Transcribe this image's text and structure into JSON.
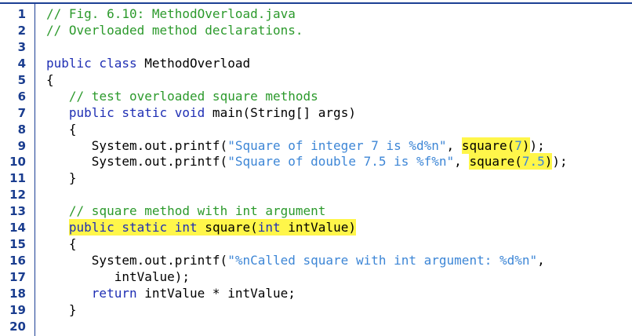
{
  "listing": {
    "lines": [
      {
        "num": "1",
        "tokens": [
          {
            "t": "// Fig. 6.10: MethodOverload.java",
            "c": "comment"
          }
        ]
      },
      {
        "num": "2",
        "tokens": [
          {
            "t": "// Overloaded method declarations.",
            "c": "comment"
          }
        ]
      },
      {
        "num": "3",
        "tokens": []
      },
      {
        "num": "4",
        "tokens": [
          {
            "t": "public class",
            "c": "kw"
          },
          {
            "t": " MethodOverload",
            "c": "plain"
          }
        ]
      },
      {
        "num": "5",
        "tokens": [
          {
            "t": "{",
            "c": "plain"
          }
        ]
      },
      {
        "num": "6",
        "tokens": [
          {
            "t": "   ",
            "c": "plain"
          },
          {
            "t": "// test overloaded square methods",
            "c": "comment"
          }
        ]
      },
      {
        "num": "7",
        "tokens": [
          {
            "t": "   ",
            "c": "plain"
          },
          {
            "t": "public static void",
            "c": "kw"
          },
          {
            "t": " main(String[] args)",
            "c": "plain"
          }
        ]
      },
      {
        "num": "8",
        "tokens": [
          {
            "t": "   {",
            "c": "plain"
          }
        ]
      },
      {
        "num": "9",
        "tokens": [
          {
            "t": "      System.out.printf(",
            "c": "plain"
          },
          {
            "t": "\"Square of integer 7 is %d%n\"",
            "c": "str"
          },
          {
            "t": ", ",
            "c": "plain"
          },
          {
            "t": "square(",
            "c": "plain",
            "hl": true
          },
          {
            "t": "7",
            "c": "str",
            "hl": true
          },
          {
            "t": ")",
            "c": "plain",
            "hl": true
          },
          {
            "t": ");",
            "c": "plain"
          }
        ]
      },
      {
        "num": "10",
        "tokens": [
          {
            "t": "      System.out.printf(",
            "c": "plain"
          },
          {
            "t": "\"Square of double 7.5 is %f%n\"",
            "c": "str"
          },
          {
            "t": ", ",
            "c": "plain"
          },
          {
            "t": "square(",
            "c": "plain",
            "hl": true
          },
          {
            "t": "7.5",
            "c": "str",
            "hl": true
          },
          {
            "t": ")",
            "c": "plain",
            "hl": true
          },
          {
            "t": ");",
            "c": "plain"
          }
        ]
      },
      {
        "num": "11",
        "tokens": [
          {
            "t": "   }",
            "c": "plain"
          }
        ]
      },
      {
        "num": "12",
        "tokens": []
      },
      {
        "num": "13",
        "tokens": [
          {
            "t": "   ",
            "c": "plain"
          },
          {
            "t": "// square method with int argument",
            "c": "comment"
          }
        ]
      },
      {
        "num": "14",
        "tokens": [
          {
            "t": "   ",
            "c": "plain"
          },
          {
            "t": "public static int",
            "c": "kw",
            "hl": true
          },
          {
            "t": " square(",
            "c": "plain",
            "hl": true
          },
          {
            "t": "int",
            "c": "kw",
            "hl": true
          },
          {
            "t": " intValue)",
            "c": "plain",
            "hl": true
          }
        ]
      },
      {
        "num": "15",
        "tokens": [
          {
            "t": "   {",
            "c": "plain"
          }
        ]
      },
      {
        "num": "16",
        "tokens": [
          {
            "t": "      System.out.printf(",
            "c": "plain"
          },
          {
            "t": "\"%nCalled square with int argument: %d%n\"",
            "c": "str"
          },
          {
            "t": ",",
            "c": "plain"
          }
        ]
      },
      {
        "num": "17",
        "tokens": [
          {
            "t": "         intValue);",
            "c": "plain"
          }
        ]
      },
      {
        "num": "18",
        "tokens": [
          {
            "t": "      ",
            "c": "plain"
          },
          {
            "t": "return",
            "c": "kw"
          },
          {
            "t": " intValue * intValue;",
            "c": "plain"
          }
        ]
      },
      {
        "num": "19",
        "tokens": [
          {
            "t": "   }",
            "c": "plain"
          }
        ]
      },
      {
        "num": "20",
        "tokens": []
      }
    ]
  },
  "colors": {
    "rule": "#1c3f94",
    "line_number": "#1a3d8f",
    "comment": "#2c9a2c",
    "keyword": "#1f2fb4",
    "string": "#3d86d6",
    "highlight": "#fff64a"
  }
}
